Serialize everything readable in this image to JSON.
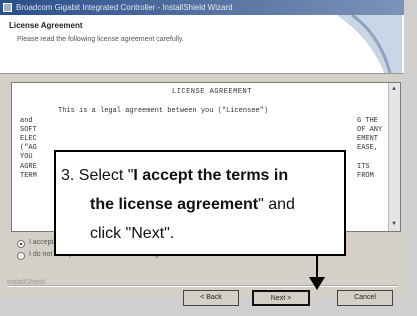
{
  "window": {
    "title": "Broadcom Gigabit Integrated Controller - InstallShield Wizard"
  },
  "header": {
    "title": "License Agreement",
    "subtitle": "Please read the following license agreement carefully."
  },
  "license": {
    "heading": "LICENSE AGREEMENT",
    "lines": [
      "This is a legal agreement between you (\"Licensee\")",
      "and",
      "SOFT",
      "ELEC",
      "(\"AG",
      "YOU",
      "AGRE",
      "TERM"
    ],
    "right_fragments": [
      "G THE",
      "OF ANY",
      "EMENT",
      "EASE,",
      "ITS",
      "FROM"
    ]
  },
  "radio": {
    "accept_label": "I accept the terms in the license agreement",
    "decline_label": "I do not accept the terms in the license agreement"
  },
  "brand_text": "InstallShield",
  "buttons": {
    "back": "< Back",
    "next": "Next >",
    "cancel": "Cancel"
  },
  "callout": {
    "step_prefix": "3. Select \"",
    "bold_part1": "I accept the terms in",
    "bold_part2": "the license agreement",
    "suffix1": "\" and",
    "line3": "click \"Next\"."
  }
}
